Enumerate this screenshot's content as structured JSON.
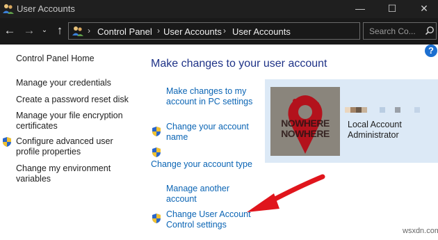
{
  "window": {
    "title": "User Accounts",
    "minimize": "—",
    "maximize": "☐",
    "close": "✕"
  },
  "nav": {
    "back": "←",
    "forward": "→",
    "recent": "⌄",
    "up": "↑",
    "separator": "›",
    "breadcrumbs": [
      "Control Panel",
      "User Accounts",
      "User Accounts"
    ],
    "dropdown": "⌄",
    "refresh": "↻",
    "search_placeholder": "Search Co..."
  },
  "help": "?",
  "sidebar": {
    "home": "Control Panel Home",
    "items": [
      "Manage your credentials",
      "Create a password reset disk",
      "Manage your file encryption certificates",
      "Configure advanced user profile properties",
      "Change my environment variables"
    ]
  },
  "main": {
    "title": "Make changes to your user account",
    "tasks": {
      "pc_settings": "Make changes to my account in PC settings",
      "change_name": "Change your account name",
      "change_type": "Change your account type",
      "manage_another": "Manage another account",
      "uac": "Change User Account Control settings"
    }
  },
  "account": {
    "avatar_text_top": "NOWHERE",
    "avatar_text_bottom": "NOWHERE",
    "line1": "Local Account",
    "line2": "Administrator"
  },
  "colors": {
    "accent": "#1e3287",
    "link": "#0a64b4",
    "card": "#dce9f6",
    "arrow": "#e0151c"
  },
  "watermark": "wsxdn.com"
}
